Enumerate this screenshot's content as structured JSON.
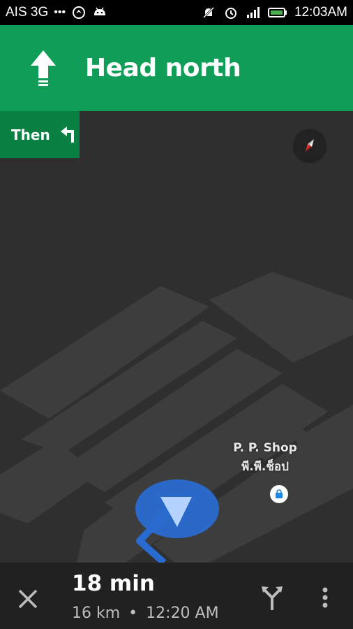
{
  "status_bar": {
    "carrier": "AIS 3G",
    "dots": "•••",
    "time": "12:03AM"
  },
  "navigation": {
    "instruction": "Head north",
    "then_label": "Then",
    "then_icon": "turn-left-icon",
    "primary_icon": "arrow-up-icon",
    "banner_color": "#0f9d58",
    "then_color": "#0b8043"
  },
  "map": {
    "poi_name_en": "P. P. Shop",
    "poi_name_th": "พี.พี.ช็อป",
    "route_color": "#2a6bd1"
  },
  "bottom_bar": {
    "duration": "18 min",
    "distance": "16 km",
    "separator": "•",
    "arrival": "12:20 AM"
  }
}
